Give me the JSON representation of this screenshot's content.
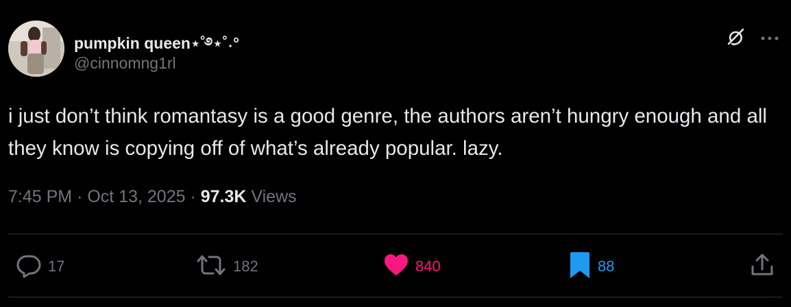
{
  "tweet": {
    "author": {
      "display_name": "pumpkin queen⋆˚࿔⋆˚˖°",
      "handle": "@cinnomng1rl"
    },
    "text": "i just don’t think romantasy is a good genre, the authors aren’t hungry enough and all they know is copying off of what’s already popular. lazy.",
    "meta": {
      "time": "7:45 PM",
      "separator": "·",
      "date": "Oct 13, 2025",
      "views_count": "97.3K",
      "views_label": "Views"
    },
    "actions": {
      "replies": "17",
      "reposts": "182",
      "likes": "840",
      "bookmarks": "88"
    },
    "icons": {
      "grok": "grok-icon",
      "more": "more-icon",
      "reply": "reply-icon",
      "repost": "repost-icon",
      "like": "heart-icon",
      "bookmark": "bookmark-icon",
      "share": "share-icon"
    },
    "colors": {
      "background": "#000000",
      "text_primary": "#e7e9ea",
      "text_secondary": "#71767b",
      "like_active": "#f91880",
      "bookmark_active": "#1d9bf0",
      "divider": "#2f3336"
    }
  }
}
